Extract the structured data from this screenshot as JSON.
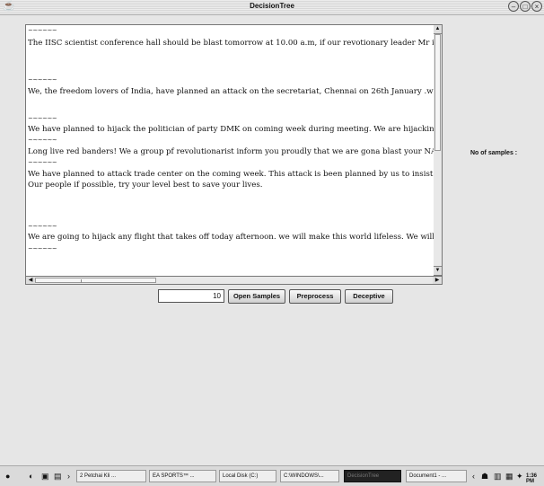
{
  "window": {
    "title": "DecisionTree",
    "controls": [
      "minimize-icon",
      "maximize-icon",
      "close-icon"
    ]
  },
  "textarea": {
    "separator": "~~~~~~",
    "samples": [
      "The IISC scientist conference hall should be blast tomorrow at 10.00 a.m, if our revotionary leader Mr is not r",
      "We, the freedom lovers of India, have planned an attack on the secretariat, Chennai on 26th January .we chall",
      "We have planned to hijack the politician of party DMK on coming week during meeting. We are hijacking hi",
      "Long live red banders! We a group pf revolutionarist inform you proudly that we are gona blast your NASA",
      "We have planned to attack trade center on the coming week. This attack is been planned by us to insist on th",
      "Our people if possible, try your level best to save your lives.",
      "We are going to hijack any flight that takes off today afternoon. we will make this world lifeless. We will go"
    ]
  },
  "controls": {
    "count_value": "10",
    "open_label": "Open Samples",
    "preprocess_label": "Preprocess",
    "deceptive_label": "Deceptive",
    "samples_label": "No of samples :"
  },
  "taskbar": {
    "items": [
      "2 Petchai Kli ...",
      "EA SPORTS™ ...",
      "Local Disk (C:)",
      "C:\\WINDOWS\\...",
      "DecisionTree",
      "Document1 - ..."
    ],
    "time": "1:36 PM"
  }
}
